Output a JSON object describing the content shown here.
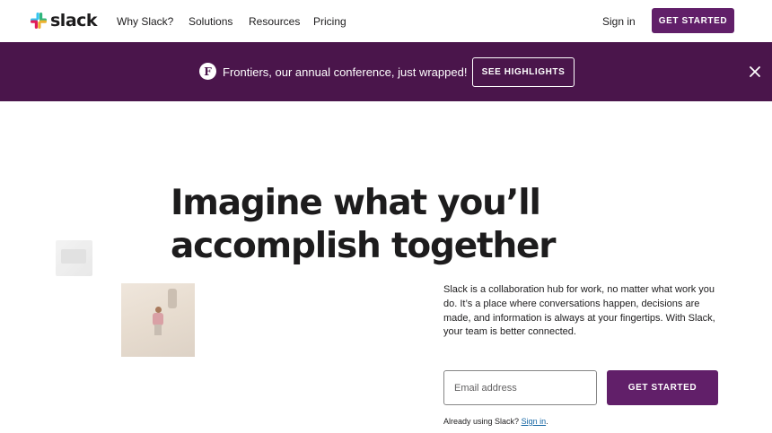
{
  "nav": {
    "logo_text": "slack",
    "links": [
      "Why Slack?",
      "Solutions",
      "Resources",
      "Pricing"
    ],
    "sign_in": "Sign in",
    "cta": "GET STARTED"
  },
  "banner": {
    "badge": "F",
    "text": "Frontiers, our annual conference, just wrapped!",
    "button": "SEE HIGHLIGHTS",
    "close_icon": "close-icon"
  },
  "hero": {
    "headline": "Imagine what you’ll accomplish together",
    "description": "Slack is a collaboration hub for work, no matter what work you do. It’s a place where conversations happen, decisions are made, and information is always at your fingertips. With Slack, your team is better connected.",
    "email_placeholder": "Email address",
    "cta": "GET STARTED",
    "already_text": "Already using Slack?",
    "sign_in_link": "Sign in",
    "trailing": "."
  },
  "colors": {
    "aubergine": "#4a154b",
    "primary_button": "#611f69",
    "link": "#1264a3"
  }
}
